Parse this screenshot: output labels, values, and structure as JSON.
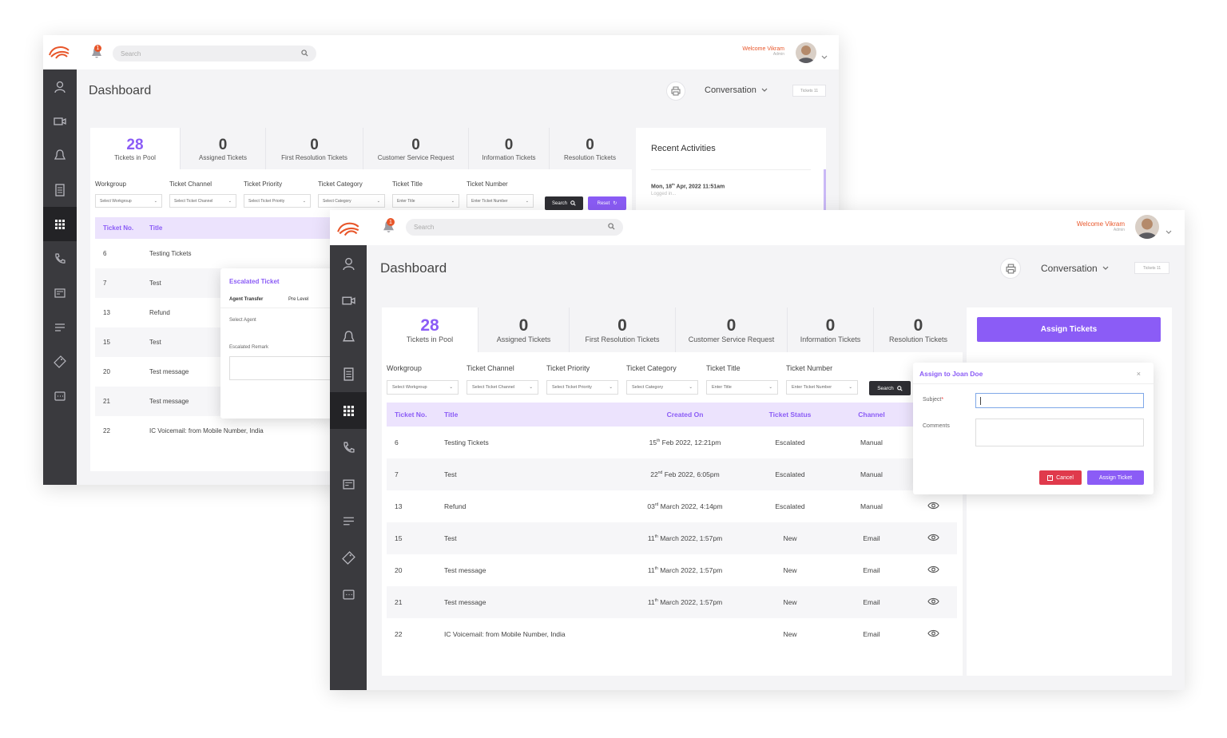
{
  "app": {
    "welcome": "Welcome Vikram",
    "role": "Admin",
    "search_placeholder": "Search",
    "notification_count": "1",
    "page_title": "Dashboard",
    "conversation_label": "Conversation",
    "tickets_badge": "Tickets 11"
  },
  "stats": [
    {
      "num": "28",
      "label": "Tickets in Pool"
    },
    {
      "num": "0",
      "label": "Assigned Tickets"
    },
    {
      "num": "0",
      "label": "First Resolution Tickets"
    },
    {
      "num": "0",
      "label": "Customer Service Request"
    },
    {
      "num": "0",
      "label": "Information Tickets"
    },
    {
      "num": "0",
      "label": "Resolution Tickets"
    }
  ],
  "filters": [
    {
      "label": "Workgroup",
      "placeholder": "Select Workgroup"
    },
    {
      "label": "Ticket Channel",
      "placeholder": "Select Ticket Channel"
    },
    {
      "label": "Ticket Priority",
      "placeholder": "Select Ticket Priority"
    },
    {
      "label": "Ticket Category",
      "placeholder": "Select Category"
    },
    {
      "label": "Ticket Title",
      "placeholder": "Enter Title"
    },
    {
      "label": "Ticket Number",
      "placeholder": "Enter Ticket Number"
    }
  ],
  "buttons": {
    "search": "Search",
    "reset": "Reset",
    "assign_tickets": "Assign Tickets",
    "cancel": "Cancel",
    "assign_ticket": "Assign Ticket"
  },
  "table": {
    "headers": [
      "Ticket No.",
      "Title",
      "Created On",
      "Ticket Status",
      "Channel"
    ],
    "rows": [
      {
        "no": "6",
        "title": "Testing Tickets",
        "day": "15",
        "sup": "th",
        "rest": " Feb 2022, 12:21pm",
        "status": "Escalated",
        "channel": "Manual"
      },
      {
        "no": "7",
        "title": "Test",
        "day": "22",
        "sup": "nd",
        "rest": " Feb 2022, 6:05pm",
        "status": "Escalated",
        "channel": "Manual"
      },
      {
        "no": "13",
        "title": "Refund",
        "day": "03",
        "sup": "rd",
        "rest": " March 2022, 4:14pm",
        "status": "Escalated",
        "channel": "Manual"
      },
      {
        "no": "15",
        "title": "Test",
        "day": "11",
        "sup": "th",
        "rest": " March 2022, 1:57pm",
        "status": "New",
        "channel": "Email"
      },
      {
        "no": "20",
        "title": "Test message",
        "day": "11",
        "sup": "th",
        "rest": " March 2022, 1:57pm",
        "status": "New",
        "channel": "Email"
      },
      {
        "no": "21",
        "title": "Test message",
        "day": "11",
        "sup": "th",
        "rest": " March 2022, 1:57pm",
        "status": "New",
        "channel": "Email"
      },
      {
        "no": "22",
        "title": "IC Voicemail: from Mobile Number, India",
        "day": "",
        "sup": "",
        "rest": "",
        "status": "New",
        "channel": "Email"
      }
    ]
  },
  "recent": {
    "title": "Recent Activities",
    "date": "Mon, 18",
    "date_sup": "th",
    "date_rest": " Apr, 2022 11:51am",
    "sub": "Logged in..."
  },
  "escalated": {
    "title": "Escalated Ticket",
    "tabs": [
      "Agent Transfer",
      "Pre Level"
    ],
    "select_agent": "Select Agent",
    "remark": "Escalated Remark"
  },
  "assign_modal": {
    "title": "Assign to Joan Doe",
    "close": "×",
    "subject": "Subject",
    "required": "*",
    "comments": "Comments"
  }
}
